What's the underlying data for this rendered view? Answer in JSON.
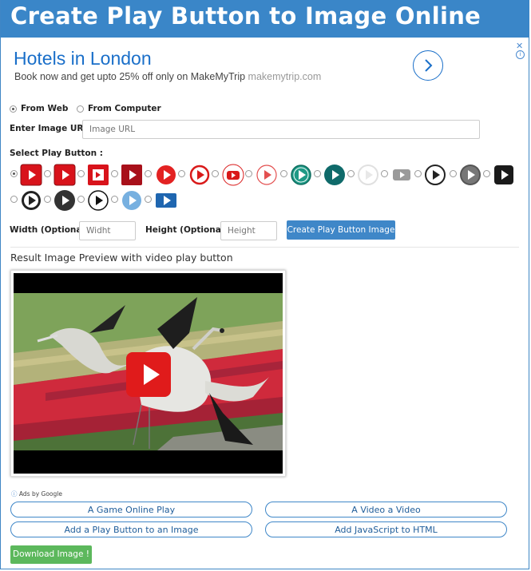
{
  "header": {
    "title": "Create Play Button to Image Online"
  },
  "ad": {
    "title": "Hotels in London",
    "subtitle": "Book now and get upto 25% off only on MakeMyTrip",
    "domain": "makemytrip.com",
    "close_glyph": "✕",
    "info_glyph": "i",
    "arrow_icon": "chevron-right-icon"
  },
  "source": {
    "from_web_label": "From Web",
    "from_computer_label": "From Computer",
    "selected": "From Web"
  },
  "image_url": {
    "label": "Enter Image URL :",
    "placeholder": "Image URL",
    "value": ""
  },
  "play_buttons": {
    "label": "Select Play Button :",
    "styles": [
      "youtube-red-square",
      "youtube-red-square",
      "red-outline-square",
      "dark-red-square",
      "red-circle",
      "red-ring-circle",
      "youtube-rounded-outline",
      "red-thin-ring",
      "teal-circle",
      "dark-teal-circle",
      "faded-ring",
      "gray-rounded-rect",
      "black-ring",
      "dark-gray-circle",
      "black-square",
      "black-ring-dark",
      "dark-circle",
      "black-outline-circle",
      "light-blue-circle",
      "blue-rect"
    ],
    "selected_index": 0
  },
  "dimensions": {
    "width_label": "Width (Optional):",
    "width_placeholder": "Widht",
    "height_label": "Height (Optional) :",
    "height_placeholder": "Height",
    "create_button": "Create Play Button Image"
  },
  "result": {
    "heading": "Result Image Preview with video play button"
  },
  "ads_footer": {
    "ads_by": "Ads by Google",
    "links": [
      "A Game Online Play",
      "A Video a Video",
      "Add a Play Button to an Image",
      "Add JavaScript to HTML"
    ]
  },
  "download": {
    "label": "Download Image !"
  },
  "colors": {
    "header_bg": "#3a86c8",
    "accent": "#3f87c8",
    "download_bg": "#5cb85c",
    "ad_title": "#1a6fc9"
  }
}
